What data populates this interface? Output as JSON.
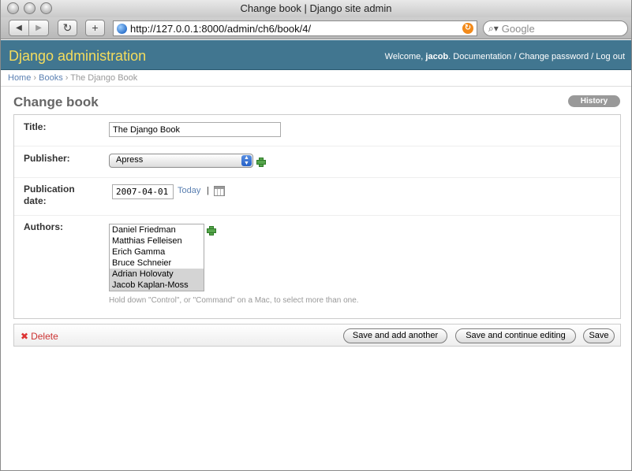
{
  "browser": {
    "window_title": "Change book | Django site admin",
    "back_icon": "◀",
    "forward_icon": "▶",
    "reload_icon": "↻",
    "add_tab_icon": "+",
    "url": "http://127.0.0.1:8000/admin/ch6/book/4/",
    "search_placeholder": "Google"
  },
  "header": {
    "brand": "Django administration",
    "welcome": "Welcome, ",
    "username": "jacob",
    "period": ". ",
    "documentation": "Documentation",
    "separator": " / ",
    "change_password": "Change password",
    "log_out": "Log out"
  },
  "breadcrumbs": {
    "home": "Home",
    "separator": " › ",
    "books": "Books",
    "current": "The Django Book"
  },
  "page": {
    "title": "Change book",
    "history_label": "History"
  },
  "form": {
    "title_label": "Title:",
    "title_value": "The Django Book",
    "publisher_label": "Publisher:",
    "publisher_value": "Apress",
    "pubdate_label_line1": "Publication",
    "pubdate_label_line2": "date:",
    "pubdate_value": "2007-04-01",
    "today_link": "Today",
    "pipe": "|",
    "authors_label": "Authors:",
    "authors": [
      {
        "name": "Daniel Friedman",
        "selected": false
      },
      {
        "name": "Matthias Felleisen",
        "selected": false
      },
      {
        "name": "Erich Gamma",
        "selected": false
      },
      {
        "name": "Bruce Schneier",
        "selected": false
      },
      {
        "name": "Adrian Holovaty",
        "selected": true
      },
      {
        "name": "Jacob Kaplan-Moss",
        "selected": true
      }
    ],
    "authors_help": "Hold down \"Control\", or \"Command\" on a Mac, to select more than one."
  },
  "submit": {
    "delete_label": "Delete",
    "save_add_another": "Save and add another",
    "save_continue": "Save and continue editing",
    "save": "Save"
  },
  "colors": {
    "header_bg": "#417690",
    "brand": "#f5dd5d",
    "link": "#5b80b2",
    "delete": "#cc3333"
  }
}
